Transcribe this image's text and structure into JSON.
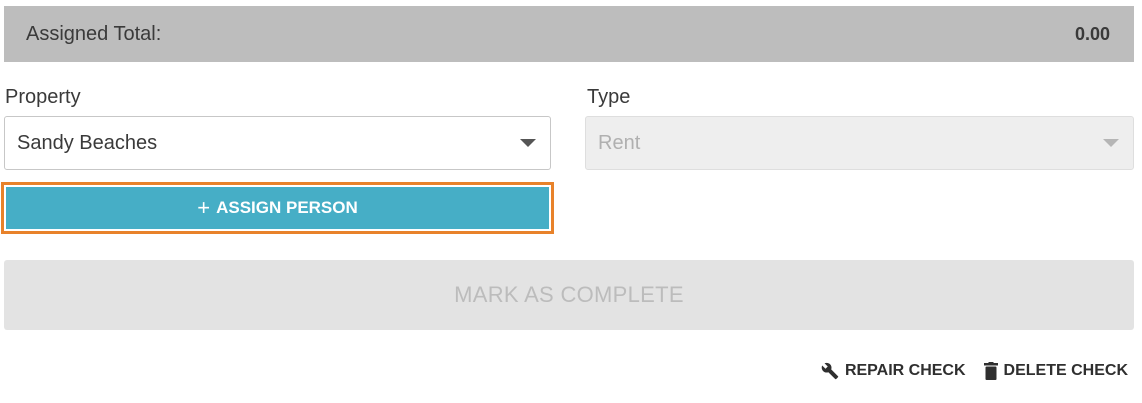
{
  "assigned_total": {
    "label": "Assigned Total:",
    "value": "0.00"
  },
  "property": {
    "label": "Property",
    "selected": "Sandy Beaches"
  },
  "type": {
    "label": "Type",
    "selected": "Rent",
    "disabled": true
  },
  "assign_button": {
    "icon": "plus-icon",
    "plus": "+",
    "label": "ASSIGN PERSON",
    "highlight_color": "#e8822a",
    "color": "#46aec6"
  },
  "complete_button": {
    "label": "MARK AS COMPLETE",
    "disabled": true
  },
  "footer": {
    "repair": {
      "icon": "wrench-icon",
      "label": "REPAIR CHECK"
    },
    "delete": {
      "icon": "trash-icon",
      "label": "DELETE CHECK"
    }
  }
}
